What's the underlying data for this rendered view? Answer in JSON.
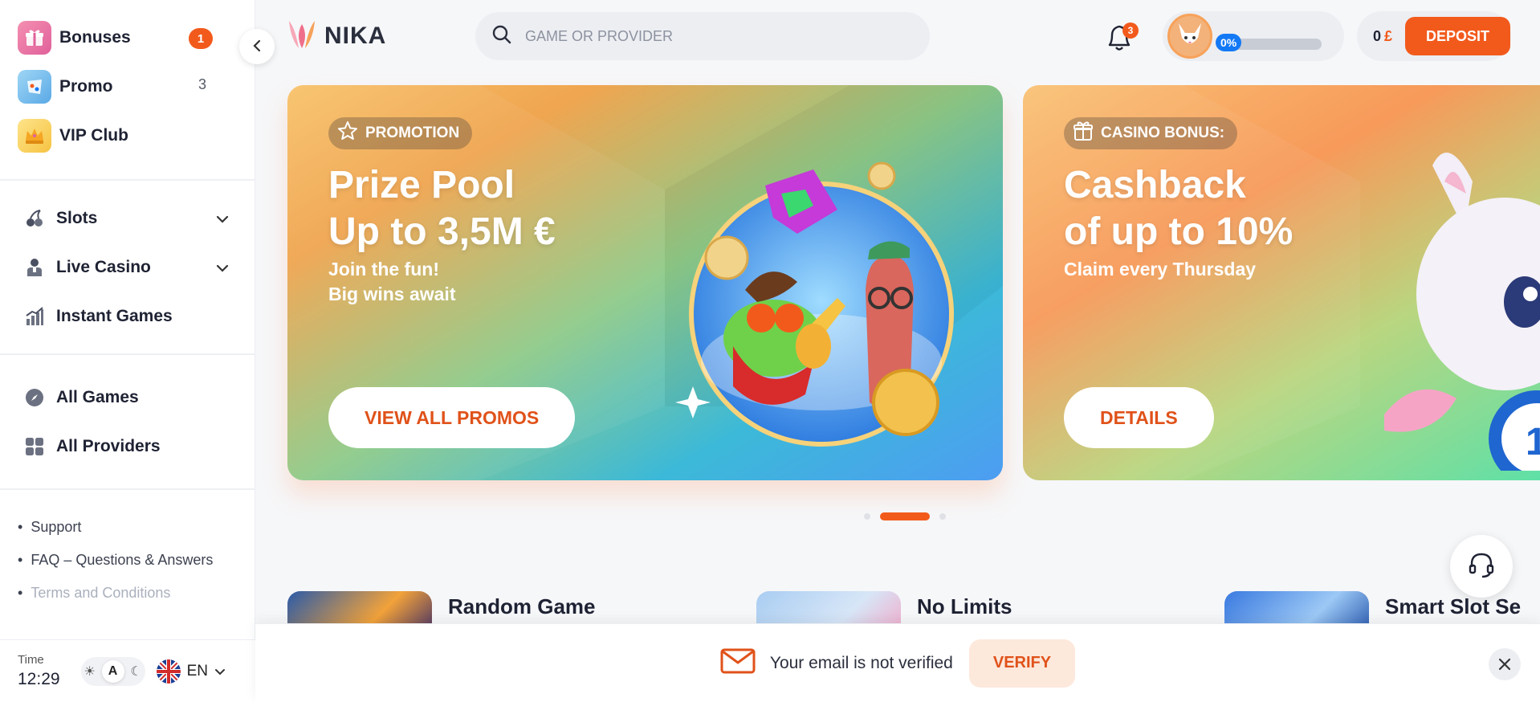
{
  "sidebar": {
    "top_items": [
      {
        "label": "Bonuses",
        "badge": "1",
        "icon": "gift-icon"
      },
      {
        "label": "Promo",
        "count": "3",
        "icon": "promo-icon"
      },
      {
        "label": "VIP Club",
        "icon": "crown-icon"
      }
    ],
    "nav_items": [
      {
        "label": "Slots",
        "icon": "cherries-icon",
        "expandable": true
      },
      {
        "label": "Live Casino",
        "icon": "dealer-icon",
        "expandable": true
      },
      {
        "label": "Instant Games",
        "icon": "chart-bars-icon",
        "expandable": false
      }
    ],
    "game_items": [
      {
        "label": "All Games",
        "icon": "compass-icon"
      },
      {
        "label": "All Providers",
        "icon": "grid-icon"
      }
    ],
    "links": [
      "Support",
      "FAQ – Questions & Answers",
      "Terms and Conditions"
    ],
    "time_label": "Time",
    "time_value": "12:29",
    "theme_auto": "A",
    "language": "EN"
  },
  "header": {
    "logo_text": "NIKA",
    "search_placeholder": "GAME OR PROVIDER",
    "notifications_count": "3",
    "progress_label": "0%",
    "progress_value": 0,
    "balance": "0",
    "currency": "£",
    "deposit_label": "DEPOSIT"
  },
  "banners": [
    {
      "tag": "PROMOTION",
      "title_line1": "Prize Pool",
      "title_line2": "Up to 3,5M €",
      "sub_line1": "Join the fun!",
      "sub_line2": "Big wins await",
      "button": "VIEW ALL PROMOS"
    },
    {
      "tag": "CASINO BONUS:",
      "title_line1": "Cashback",
      "title_line2": "of up to 10%",
      "sub_line1": "Claim every Thursday",
      "button": "DETAILS"
    }
  ],
  "carousel": {
    "count": 3,
    "active": 1
  },
  "games": [
    {
      "name": "Random Game"
    },
    {
      "name": "No Limits"
    },
    {
      "name": "Smart Slot Se"
    }
  ],
  "verify": {
    "message": "Your email is not verified",
    "button": "VERIFY"
  },
  "colors": {
    "accent": "#f25a1c",
    "progress": "#1479f5"
  }
}
